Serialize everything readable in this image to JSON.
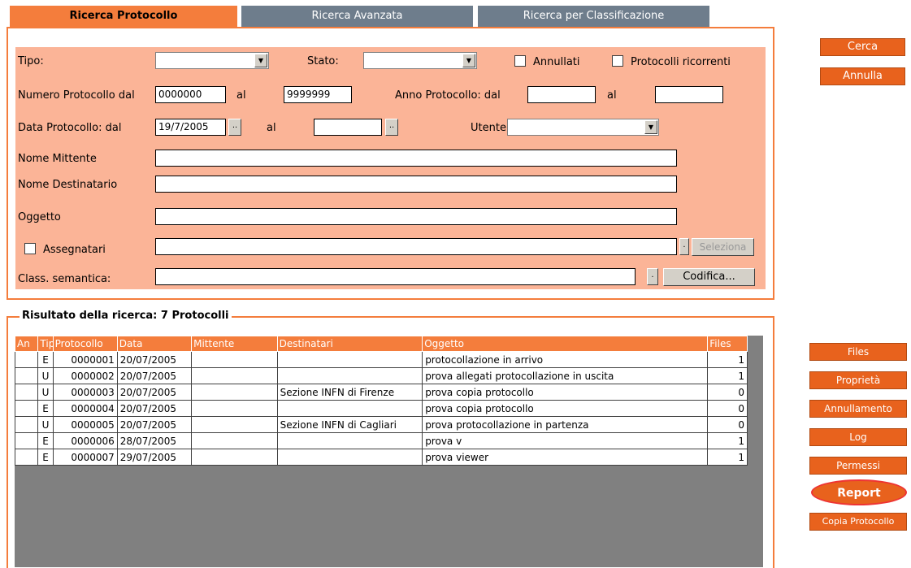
{
  "tabs": [
    {
      "label": "Ricerca Protocollo"
    },
    {
      "label": "Ricerca Avanzata"
    },
    {
      "label": "Ricerca per Classificazione"
    }
  ],
  "form": {
    "tipo_label": "Tipo:",
    "stato_label": "Stato:",
    "annullati_label": "Annullati",
    "ricorrenti_label": "Protocolli ricorrenti",
    "numero_label": "Numero Protocollo dal",
    "numero_from": "0000000",
    "al_label": "al",
    "numero_to": "9999999",
    "anno_label": "Anno Protocollo:  dal",
    "anno_from": "",
    "anno_to": "",
    "data_label": "Data Protocollo: dal",
    "data_from": "19/7/2005",
    "data_to": "",
    "utente_label": "Utente",
    "mittente_label": "Nome Mittente",
    "destinatario_label": "Nome Destinatario",
    "oggetto_label": "Oggetto",
    "assegnatari_label": "Assegnatari",
    "seleziona_label": "Seleziona",
    "class_label": "Class. semantica:",
    "codifica_label": "Codifica...",
    "dots": "..",
    "dot": "."
  },
  "actions": {
    "cerca": "Cerca",
    "annulla": "Annulla",
    "files": "Files",
    "proprieta": "Proprietà",
    "annullamento": "Annullamento",
    "log": "Log",
    "permessi": "Permessi",
    "report": "Report",
    "copia": "Copia Protocollo"
  },
  "results": {
    "title": "Risultato della ricerca: 7 Protocolli",
    "columns": [
      "An",
      "Tip",
      "Protocollo",
      "Data",
      "Mittente",
      "Destinatari",
      "Oggetto",
      "Files"
    ],
    "rows": [
      [
        "",
        "E",
        "0000001",
        "20/07/2005",
        "",
        "",
        "protocollazione in arrivo",
        "1"
      ],
      [
        "",
        "U",
        "0000002",
        "20/07/2005",
        "",
        "",
        "prova allegati protocollazione in uscita",
        "1"
      ],
      [
        "",
        "U",
        "0000003",
        "20/07/2005",
        "",
        "Sezione INFN di Firenze",
        "prova copia protocollo",
        "0"
      ],
      [
        "",
        "E",
        "0000004",
        "20/07/2005",
        "",
        "",
        "prova  copia protocollo",
        "0"
      ],
      [
        "",
        "U",
        "0000005",
        "20/07/2005",
        "",
        "Sezione INFN di Cagliari",
        "prova protocollazione in partenza",
        "0"
      ],
      [
        "",
        "E",
        "0000006",
        "28/07/2005",
        "",
        "",
        "prova v",
        "1"
      ],
      [
        "",
        "E",
        "0000007",
        "29/07/2005",
        "",
        "",
        "prova viewer",
        "1"
      ]
    ]
  }
}
